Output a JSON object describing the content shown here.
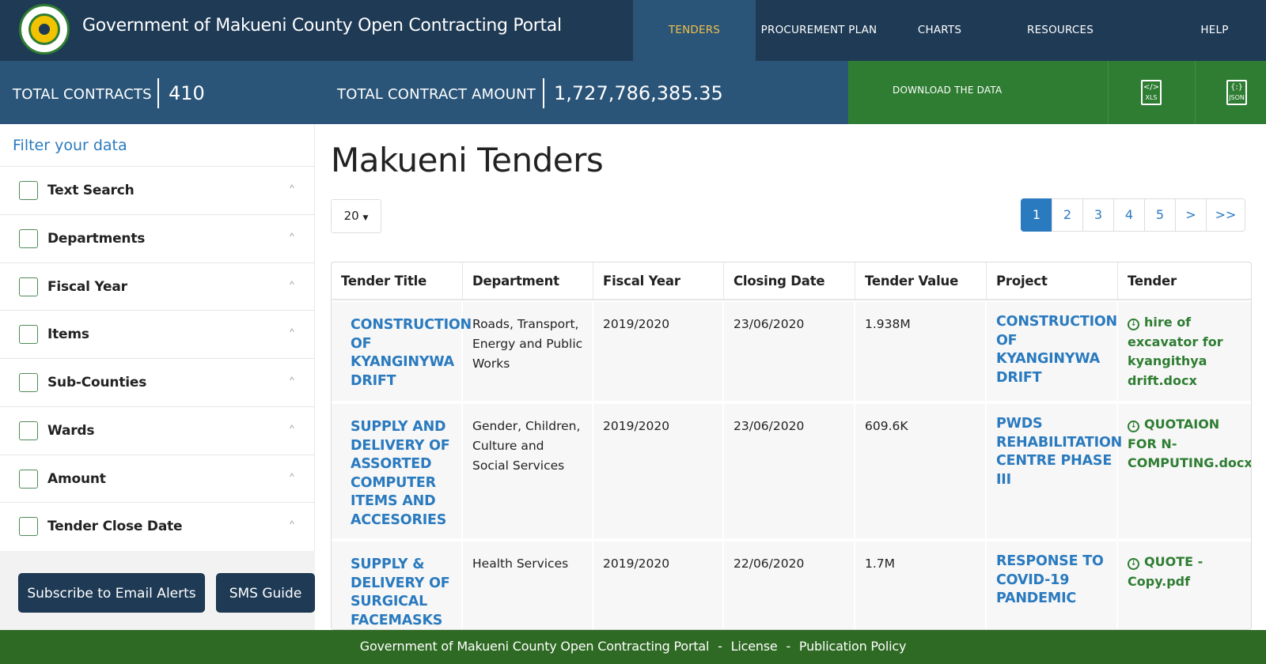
{
  "header": {
    "site_title": "Government of Makueni County Open Contracting Portal",
    "logo_icon": "county-seal-icon",
    "nav": [
      {
        "label": "TENDERS",
        "active": true
      },
      {
        "label": "PROCUREMENT PLAN",
        "active": false
      },
      {
        "label": "CHARTS",
        "active": false
      },
      {
        "label": "RESOURCES",
        "active": false
      },
      {
        "label": "HELP",
        "active": false
      }
    ]
  },
  "stats": {
    "total_contracts_label": "TOTAL CONTRACTS",
    "total_contracts_value": "410",
    "total_amount_label": "TOTAL CONTRACT AMOUNT",
    "total_amount_value": "1,727,786,385.35",
    "download_label": "DOWNLOAD THE DATA",
    "xls_label": "XLS",
    "json_label": "JSON"
  },
  "sidebar": {
    "title": "Filter your data",
    "filters": [
      {
        "label": "Text Search",
        "icon": "text-search-icon"
      },
      {
        "label": "Departments",
        "icon": "org-chart-icon"
      },
      {
        "label": "Fiscal Year",
        "icon": "calendar-icon"
      },
      {
        "label": "Items",
        "icon": "checklist-icon"
      },
      {
        "label": "Sub-Counties",
        "icon": "map-pin-icon"
      },
      {
        "label": "Wards",
        "icon": "location-icon"
      },
      {
        "label": "Amount",
        "icon": "money-icon"
      },
      {
        "label": "Tender Close Date",
        "icon": "calendar-grid-icon"
      }
    ],
    "subscribe_button": "Subscribe to Email Alerts",
    "sms_button": "SMS Guide"
  },
  "main": {
    "title": "Makueni Tenders",
    "per_page": "20",
    "pagination": [
      "1",
      "2",
      "3",
      "4",
      "5",
      ">",
      ">>"
    ],
    "columns": [
      "Tender Title",
      "Department",
      "Fiscal Year",
      "Closing Date",
      "Tender Value",
      "Project",
      "Tender Documents"
    ],
    "rows": [
      {
        "title": "CONSTRUCTION OF KYANGINYWA DRIFT",
        "department": "Roads, Transport, Energy and Public Works",
        "fiscal_year": "2019/2020",
        "closing_date": "23/06/2020",
        "value": "1.938M",
        "project": "CONSTRUCTION OF KYANGINYWA DRIFT",
        "document": "hire of excavator for kyangithya drift.docx"
      },
      {
        "title": "SUPPLY AND DELIVERY OF ASSORTED COMPUTER ITEMS AND ACCESORIES",
        "department": "Gender, Children, Culture and Social Services",
        "fiscal_year": "2019/2020",
        "closing_date": "23/06/2020",
        "value": "609.6K",
        "project": "PWDS REHABILITATION CENTRE PHASE III",
        "document": "QUOTAION FOR N-COMPUTING.docx"
      },
      {
        "title": "SUPPLY & DELIVERY OF SURGICAL FACEMASKS",
        "department": "Health Services",
        "fiscal_year": "2019/2020",
        "closing_date": "22/06/2020",
        "value": "1.7M",
        "project": "RESPONSE TO COVID-19 PANDEMIC",
        "document": "QUOTE - Copy.pdf"
      }
    ]
  },
  "footer": {
    "site": "Government of Makueni County Open Contracting Portal",
    "separator": "-",
    "license": "License",
    "policy": "Publication Policy"
  },
  "colors": {
    "nav_bg": "#1e3a55",
    "stats_bg": "#2a5478",
    "accent_green": "#2e7d32",
    "link_blue": "#2a7abf",
    "active_nav_text": "#f0c04c"
  }
}
